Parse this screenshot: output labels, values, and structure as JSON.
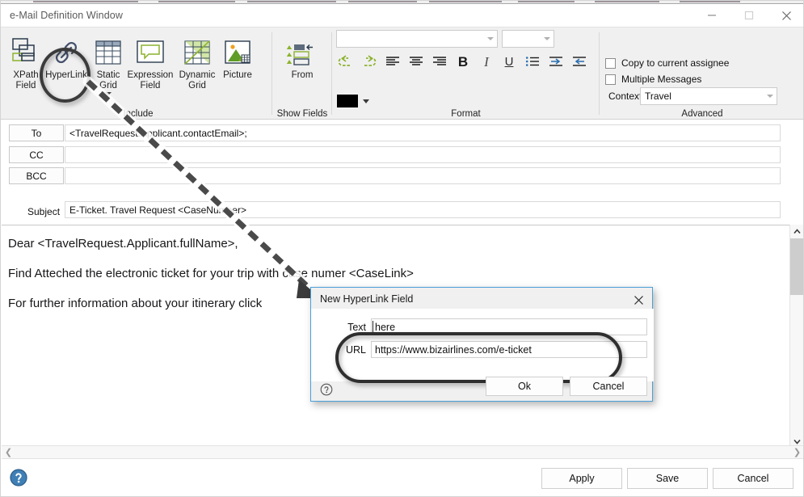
{
  "window": {
    "title": "e-Mail Definition Window",
    "controls": {
      "minimize": "minimize-icon",
      "maximize": "maximize-icon",
      "close": "close-icon"
    }
  },
  "ribbon": {
    "groups": [
      {
        "label": "Include"
      },
      {
        "label": "Show Fields"
      },
      {
        "label": "Format"
      },
      {
        "label": "Advanced"
      }
    ],
    "include_buttons": [
      {
        "label_line1": "XPath",
        "label_line2": "Field",
        "icon": "xpath-field-icon",
        "has_caret": false
      },
      {
        "label_line1": "HyperLink",
        "label_line2": "",
        "icon": "hyperlink-icon",
        "has_caret": false
      },
      {
        "label_line1": "Static",
        "label_line2": "Grid",
        "icon": "static-grid-icon",
        "has_caret": true
      },
      {
        "label_line1": "Expression",
        "label_line2": "Field",
        "icon": "expression-field-icon",
        "has_caret": false
      },
      {
        "label_line1": "Dynamic",
        "label_line2": "Grid",
        "icon": "dynamic-grid-icon",
        "has_caret": false
      },
      {
        "label_line1": "Picture",
        "label_line2": "",
        "icon": "picture-icon",
        "has_caret": false
      }
    ],
    "show_fields_button": {
      "label": "From",
      "icon": "from-field-icon"
    },
    "format": {
      "font_name": {
        "value": "",
        "placeholder": ""
      },
      "font_size": {
        "value": "",
        "placeholder": ""
      },
      "buttons": [
        {
          "name": "undo-button",
          "icon": "undo-icon"
        },
        {
          "name": "redo-button",
          "icon": "redo-icon"
        },
        {
          "name": "align-left-button",
          "icon": "align-left-icon"
        },
        {
          "name": "align-center-button",
          "icon": "align-center-icon"
        },
        {
          "name": "align-right-button",
          "icon": "align-right-icon"
        },
        {
          "name": "bold-button",
          "icon": "bold-icon",
          "glyph": "B"
        },
        {
          "name": "italic-button",
          "icon": "italic-icon",
          "glyph": "I"
        },
        {
          "name": "underline-button",
          "icon": "underline-icon",
          "glyph": "U"
        },
        {
          "name": "bullet-list-button",
          "icon": "bullet-list-icon"
        },
        {
          "name": "increase-indent-button",
          "icon": "increase-indent-icon"
        },
        {
          "name": "decrease-indent-button",
          "icon": "decrease-indent-icon"
        }
      ],
      "text_color": {
        "name": "text-color-button",
        "color": "#000000"
      }
    },
    "advanced": {
      "copy_to_current_assignee": {
        "label": "Copy to current assignee",
        "checked": false
      },
      "multiple_messages": {
        "label": "Multiple Messages",
        "checked": false
      },
      "context_label": "Context",
      "context_value": "Travel"
    }
  },
  "addresses": {
    "to": {
      "button": "To",
      "value": "<TravelRequest.Applicant.contactEmail>;"
    },
    "cc": {
      "button": "CC",
      "value": ""
    },
    "bcc": {
      "button": "BCC",
      "value": ""
    },
    "subject": {
      "label": "Subject",
      "value": "E-Ticket. Travel Request <CaseNumber>"
    }
  },
  "body": {
    "lines": [
      "Dear <TravelRequest.Applicant.fullName>,",
      "Find Atteched the electronic ticket for your trip with case numer <CaseLink>",
      "For further information about your itinerary click"
    ]
  },
  "footer": {
    "apply": "Apply",
    "save": "Save",
    "cancel": "Cancel",
    "help_icon": "help-question-icon"
  },
  "dialog": {
    "title": "New HyperLink Field",
    "close_icon": "close-icon",
    "fields": [
      {
        "label": "Text",
        "value": "here"
      },
      {
        "label": "URL",
        "value": "https://www.bizairlines.com/e-ticket"
      }
    ],
    "ok": "Ok",
    "cancel": "Cancel",
    "help_icon": "help-circle-icon"
  },
  "annotations": {
    "circle_target": "hyperlink-ribbon-button",
    "arrow": "dashed-arrow-callout",
    "rounded_highlight": "dialog-fields-highlight"
  },
  "colors": {
    "accent_green": "#8cb22e",
    "accent_teal": "#1f5a5e",
    "dialog_border": "#4a9fd8",
    "ribbon_bg": "#f0f0f0",
    "annotation": "#3b3b3b"
  }
}
